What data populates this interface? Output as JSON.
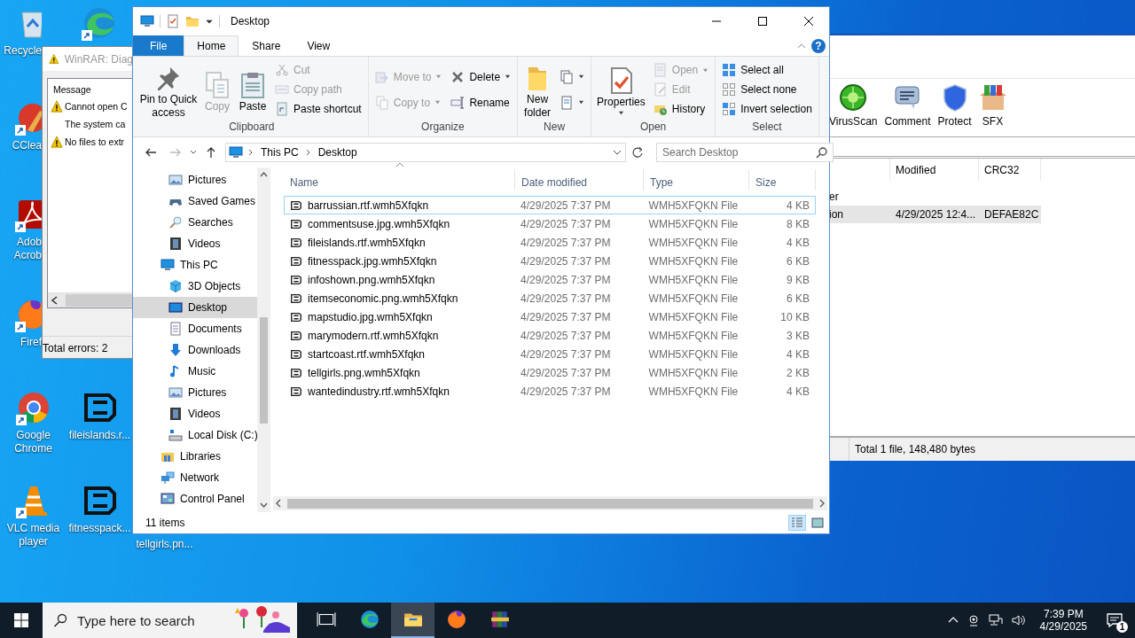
{
  "desktop": {
    "icons": [
      {
        "label": "Recycle",
        "kind": "recycle"
      },
      {
        "kind": "edge"
      },
      {
        "label": "CClea",
        "kind": "ccleaner"
      },
      {
        "label": "Adob Acrob",
        "kind": "acrobat"
      },
      {
        "label": "Firef",
        "kind": "firefox"
      },
      {
        "label": "Google Chrome",
        "kind": "chrome"
      },
      {
        "label": "fileislands.r...",
        "kind": "file"
      },
      {
        "label": "VLC media player",
        "kind": "vlc"
      },
      {
        "label": "fitnesspack...",
        "kind": "file"
      },
      {
        "label": "tellgirls.pn..."
      }
    ]
  },
  "winrar_main": {
    "toolbar": [
      {
        "label": "VirusScan",
        "kind": "virusscan"
      },
      {
        "label": "Comment",
        "kind": "comment"
      },
      {
        "label": "Protect",
        "kind": "protect"
      },
      {
        "label": "SFX",
        "kind": "sfx"
      }
    ],
    "columns": [
      "Modified",
      "CRC32"
    ],
    "rows": [
      {
        "name": "er",
        "selected": false
      },
      {
        "name": "ion",
        "modified": "4/29/2025 12:4...",
        "crc32": "DEFAE82C",
        "selected": true
      }
    ],
    "status_bar": "Total 1 file, 148,480 bytes"
  },
  "winrar_diagnostic": {
    "title": "WinRAR: Diag",
    "column": "Message",
    "messages": [
      {
        "text": "Cannot open C",
        "kind": "warning"
      },
      {
        "text": "The system ca",
        "kind": "detail"
      },
      {
        "text": "No files to extr",
        "kind": "warning"
      }
    ],
    "summary": "Total errors: 2"
  },
  "explorer": {
    "title": "Desktop",
    "ribbon_tabs": [
      {
        "label": "File",
        "kind": "file",
        "selected": false
      },
      {
        "label": "Home",
        "kind": "tab",
        "selected": true
      },
      {
        "label": "Share",
        "kind": "tab",
        "selected": false
      },
      {
        "label": "View",
        "kind": "tab",
        "selected": false
      }
    ],
    "help_label": "?",
    "ribbon_groups": [
      {
        "label": "Clipboard",
        "columns": [
          [
            {
              "lines": [
                "Pin to Quick",
                "access"
              ],
              "kind": "pin",
              "disabled": false,
              "dropdown": false
            }
          ],
          [
            {
              "lines": [
                "Copy"
              ],
              "kind": "copy",
              "disabled": true,
              "dropdown": false
            }
          ],
          [
            {
              "lines": [
                "Paste"
              ],
              "kind": "paste",
              "disabled": false,
              "dropdown": false
            }
          ],
          [
            {
              "label": "Cut",
              "kind": "cut",
              "disabled": true,
              "dropdown": false
            },
            {
              "label": "Copy path",
              "kind": "copypath",
              "disabled": true,
              "dropdown": false
            },
            {
              "label": "Paste shortcut",
              "kind": "pasteshortcut",
              "disabled": false,
              "dropdown": false
            }
          ]
        ]
      },
      {
        "label": "Organize",
        "columns": [
          [
            {
              "label": "Move to",
              "kind": "moveto",
              "disabled": true,
              "dropdown": true
            },
            {
              "label": "Copy to",
              "kind": "copyto",
              "disabled": true,
              "dropdown": true
            }
          ],
          [
            {
              "label": "Delete",
              "kind": "delete",
              "disabled": false,
              "dropdown": true
            },
            {
              "label": "Rename",
              "kind": "rename",
              "disabled": false,
              "dropdown": false
            }
          ]
        ]
      },
      {
        "label": "New",
        "columns": [
          [
            {
              "lines": [
                "New",
                "folder"
              ],
              "kind": "newfolder",
              "disabled": false,
              "dropdown": false
            }
          ],
          [
            {
              "kind": "newitem",
              "disabled": false,
              "dropdown": true
            },
            {
              "kind": "easyaccess",
              "disabled": false,
              "dropdown": true
            }
          ]
        ]
      },
      {
        "label": "Open",
        "columns": [
          [
            {
              "lines": [
                "Properties"
              ],
              "kind": "properties",
              "disabled": false,
              "dropdown": true
            }
          ],
          [
            {
              "label": "Open",
              "kind": "open",
              "disabled": true,
              "dropdown": true
            },
            {
              "label": "Edit",
              "kind": "edit",
              "disabled": true,
              "dropdown": false
            },
            {
              "label": "History",
              "kind": "history",
              "disabled": false,
              "dropdown": false
            }
          ]
        ]
      },
      {
        "label": "Select",
        "columns": [
          [
            {
              "label": "Select all",
              "kind": "selectall",
              "disabled": false,
              "dropdown": false
            },
            {
              "label": "Select none",
              "kind": "selectnone",
              "disabled": false,
              "dropdown": false
            },
            {
              "label": "Invert selection",
              "kind": "invert",
              "disabled": false,
              "dropdown": false
            }
          ]
        ]
      }
    ],
    "breadcrumb": [
      "This PC",
      "Desktop"
    ],
    "search": {
      "placeholder": "Search Desktop"
    },
    "nav_pane": {
      "continued_children": [
        {
          "label": "Pictures",
          "kind": "pictures",
          "selected": false
        },
        {
          "label": "Saved Games",
          "kind": "games",
          "selected": false
        },
        {
          "label": "Searches",
          "kind": "searches",
          "selected": false
        },
        {
          "label": "Videos",
          "kind": "videos",
          "selected": false
        }
      ],
      "items": [
        {
          "label": "This PC",
          "kind": "pc",
          "selected": false,
          "children": [
            {
              "label": "3D Objects",
              "kind": "objects3d",
              "selected": false
            },
            {
              "label": "Desktop",
              "kind": "desktop",
              "selected": true
            },
            {
              "label": "Documents",
              "kind": "documents",
              "selected": false
            },
            {
              "label": "Downloads",
              "kind": "downloads",
              "selected": false
            },
            {
              "label": "Music",
              "kind": "music",
              "selected": false
            },
            {
              "label": "Pictures",
              "kind": "pictures",
              "selected": false
            },
            {
              "label": "Videos",
              "kind": "videos",
              "selected": false
            },
            {
              "label": "Local Disk (C:)",
              "kind": "disk",
              "selected": false
            }
          ]
        },
        {
          "label": "Libraries",
          "kind": "libraries",
          "selected": false
        },
        {
          "label": "Network",
          "kind": "network",
          "selected": false
        },
        {
          "label": "Control Panel",
          "kind": "control",
          "selected": false
        }
      ]
    },
    "columns": [
      "Name",
      "Date modified",
      "Type",
      "Size"
    ],
    "files": [
      {
        "name": "barrussian.rtf.wmh5Xfqkn",
        "date_modified": "4/29/2025 7:37 PM",
        "type": "WMH5XFQKN File",
        "size": "4 KB",
        "focused": true
      },
      {
        "name": "commentsuse.jpg.wmh5Xfqkn",
        "date_modified": "4/29/2025 7:37 PM",
        "type": "WMH5XFQKN File",
        "size": "8 KB",
        "focused": false
      },
      {
        "name": "fileislands.rtf.wmh5Xfqkn",
        "date_modified": "4/29/2025 7:37 PM",
        "type": "WMH5XFQKN File",
        "size": "4 KB",
        "focused": false
      },
      {
        "name": "fitnesspack.jpg.wmh5Xfqkn",
        "date_modified": "4/29/2025 7:37 PM",
        "type": "WMH5XFQKN File",
        "size": "6 KB",
        "focused": false
      },
      {
        "name": "infoshown.png.wmh5Xfqkn",
        "date_modified": "4/29/2025 7:37 PM",
        "type": "WMH5XFQKN File",
        "size": "9 KB",
        "focused": false
      },
      {
        "name": "itemseconomic.png.wmh5Xfqkn",
        "date_modified": "4/29/2025 7:37 PM",
        "type": "WMH5XFQKN File",
        "size": "6 KB",
        "focused": false
      },
      {
        "name": "mapstudio.jpg.wmh5Xfqkn",
        "date_modified": "4/29/2025 7:37 PM",
        "type": "WMH5XFQKN File",
        "size": "10 KB",
        "focused": false
      },
      {
        "name": "marymodern.rtf.wmh5Xfqkn",
        "date_modified": "4/29/2025 7:37 PM",
        "type": "WMH5XFQKN File",
        "size": "3 KB",
        "focused": false
      },
      {
        "name": "startcoast.rtf.wmh5Xfqkn",
        "date_modified": "4/29/2025 7:37 PM",
        "type": "WMH5XFQKN File",
        "size": "4 KB",
        "focused": false
      },
      {
        "name": "tellgirls.png.wmh5Xfqkn",
        "date_modified": "4/29/2025 7:37 PM",
        "type": "WMH5XFQKN File",
        "size": "2 KB",
        "focused": false
      },
      {
        "name": "wantedindustry.rtf.wmh5Xfqkn",
        "date_modified": "4/29/2025 7:37 PM",
        "type": "WMH5XFQKN File",
        "size": "4 KB",
        "focused": false
      }
    ],
    "status_bar": "11 items",
    "view_buttons": [
      {
        "kind": "details",
        "selected": true
      },
      {
        "kind": "large_icons",
        "selected": false
      }
    ]
  },
  "taskbar": {
    "search": {
      "placeholder": "Type here to search"
    },
    "apps": [
      {
        "kind": "task_view",
        "active": false
      },
      {
        "kind": "edge",
        "active": false
      },
      {
        "kind": "explorer",
        "active": true
      },
      {
        "kind": "firefox",
        "active": false
      },
      {
        "kind": "winrar",
        "active": false
      }
    ],
    "clock": {
      "time": "7:39 PM",
      "date": "4/29/2025"
    },
    "notification_count": "1"
  }
}
